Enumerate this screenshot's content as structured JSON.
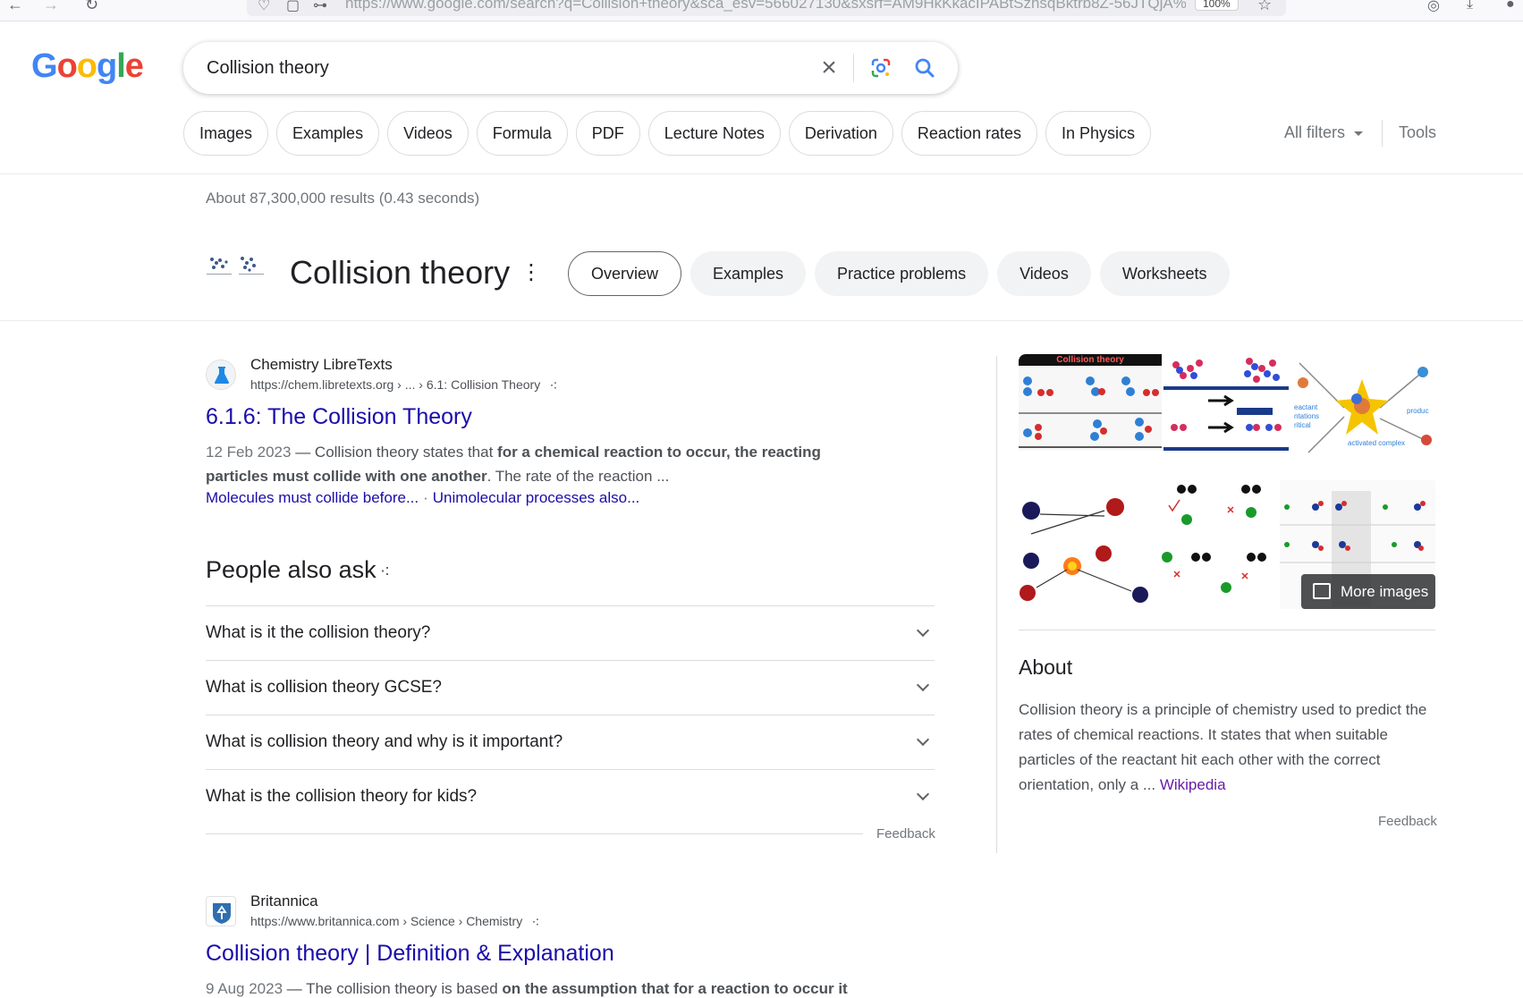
{
  "browser": {
    "url": "https://www.google.com/search?q=Collision+theory&sca_esv=566027130&sxsrf=AM9HkKkacIPABtSzhsqBktrb8Z-56JTQjA%",
    "zoom": "100%"
  },
  "colors": {
    "link": "#1a0dab",
    "visited": "#681da8",
    "text": "#202124",
    "muted": "#70757a"
  },
  "search": {
    "query": "Collision theory"
  },
  "filters": {
    "chips": [
      "Images",
      "Examples",
      "Videos",
      "Formula",
      "PDF",
      "Lecture Notes",
      "Derivation",
      "Reaction rates",
      "In Physics"
    ],
    "all_filters": "All filters",
    "tools": "Tools"
  },
  "stats": "About 87,300,000 results (0.43 seconds)",
  "entity": {
    "title": "Collision theory",
    "tabs": [
      "Overview",
      "Examples",
      "Practice problems",
      "Videos",
      "Worksheets"
    ],
    "active_tab": "Overview"
  },
  "results": [
    {
      "site_name": "Chemistry LibreTexts",
      "url": "https://chem.libretexts.org › ... › 6.1: Collision Theory",
      "title": "6.1.6: The Collision Theory",
      "date": "12 Feb 2023",
      "snippet_pre": "Collision theory states that ",
      "snippet_bold": "for a chemical reaction to occur, the reacting particles must collide with one another",
      "snippet_post": ". The rate of the reaction ...",
      "sublinks": [
        "Molecules must collide before...",
        "Unimolecular processes also..."
      ]
    },
    {
      "site_name": "Britannica",
      "url": "https://www.britannica.com › Science › Chemistry",
      "title": "Collision theory | Definition & Explanation",
      "date": "9 Aug 2023",
      "snippet_pre": "The collision theory is based ",
      "snippet_bold": "on the assumption that for a reaction to occur it",
      "snippet_post": ""
    }
  ],
  "people_also_ask": {
    "title": "People also ask",
    "questions": [
      "What is it the collision theory?",
      "What is collision theory GCSE?",
      "What is collision theory and why is it important?",
      "What is the collision theory for kids?"
    ],
    "feedback": "Feedback"
  },
  "knowledge_panel": {
    "image_labels": {
      "banner": "Collision theory",
      "reactant": "eactant",
      "orientations": "ntations",
      "critical": "ritical",
      "activated": "activated complex",
      "product": "produc"
    },
    "more_images": "More images",
    "about_title": "About",
    "description": "Collision theory is a principle of chemistry used to predict the rates of chemical reactions. It states that when suitable particles of the reactant hit each other with the correct orientation, only a ...",
    "source": "Wikipedia",
    "feedback": "Feedback"
  }
}
